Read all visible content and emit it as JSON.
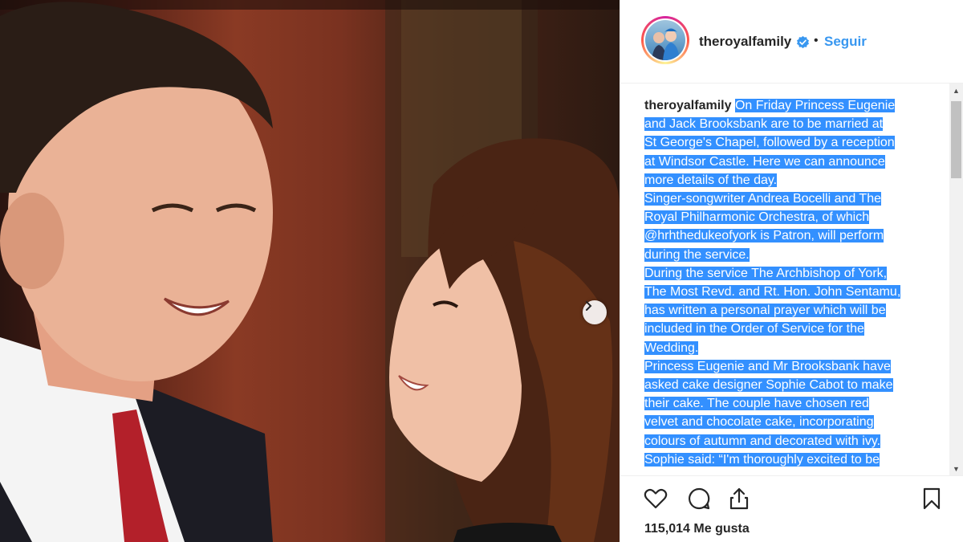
{
  "post": {
    "username": "theroyalfamily",
    "separator": "•",
    "follow_label": "Seguir",
    "caption_user": "theroyalfamily",
    "caption_lines": [
      "On Friday Princess Eugenie",
      "and Jack Brooksbank are to be married at",
      "St George's Chapel, followed by a reception",
      "at Windsor Castle. Here we can announce",
      "more details of the day.",
      "Singer-songwriter Andrea Bocelli and The",
      "Royal Philharmonic Orchestra, of which",
      "@hrhthedukeofyork is Patron, will perform",
      "during the service.",
      "During the service The Archbishop of York,",
      "The Most Revd. and Rt. Hon. John Sentamu,",
      "has written a personal prayer which will be",
      "included in the Order of Service for the",
      "Wedding.",
      "Princess Eugenie and Mr Brooksbank have",
      "asked cake designer Sophie Cabot to make",
      "their cake. The couple have chosen red",
      "velvet and chocolate cake, incorporating",
      "colours of autumn and decorated with ivy.",
      "Sophie said: “I'm thoroughly excited to be"
    ],
    "likes_text": "115,014 Me gusta"
  },
  "icons": {
    "verified": "verified-badge-icon",
    "next": "chevron-right-icon",
    "like": "heart-icon",
    "comment": "comment-icon",
    "share": "share-icon",
    "save": "bookmark-icon"
  },
  "colors": {
    "selection": "#3390ff",
    "link": "#3897f0",
    "text": "#262626"
  }
}
